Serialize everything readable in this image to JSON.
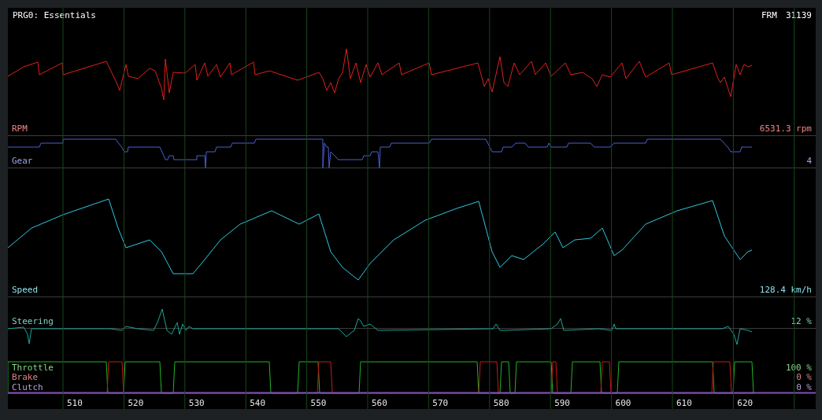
{
  "header": {
    "title": "PRG0: Essentials",
    "frame_label": "FRM",
    "frame_value": "31139"
  },
  "channels": [
    {
      "kind": "rpm",
      "label": "RPM",
      "reading": "6531.3 rpm",
      "color": "#e0201e"
    },
    {
      "kind": "gear",
      "label": "Gear",
      "reading": "4",
      "color": "#4a5fd0"
    },
    {
      "kind": "speed",
      "label": "Speed",
      "reading": "128.4 km/h",
      "color": "#2fc8e0"
    },
    {
      "kind": "steering",
      "label": "Steering",
      "reading": "12 %",
      "color": "#18a898"
    }
  ],
  "pedals": [
    {
      "kind": "throttle",
      "label": "Throttle",
      "reading": "100 %",
      "color": "#22b422"
    },
    {
      "kind": "brake",
      "label": "Brake",
      "reading": "0 %",
      "color": "#c41a1a"
    },
    {
      "kind": "clutch",
      "label": "Clutch",
      "reading": "0 %",
      "color": "#8450b8"
    }
  ],
  "x_axis": {
    "ticks": [
      "510",
      "520",
      "530",
      "540",
      "550",
      "560",
      "570",
      "580",
      "590",
      "600",
      "610",
      "620"
    ]
  }
}
